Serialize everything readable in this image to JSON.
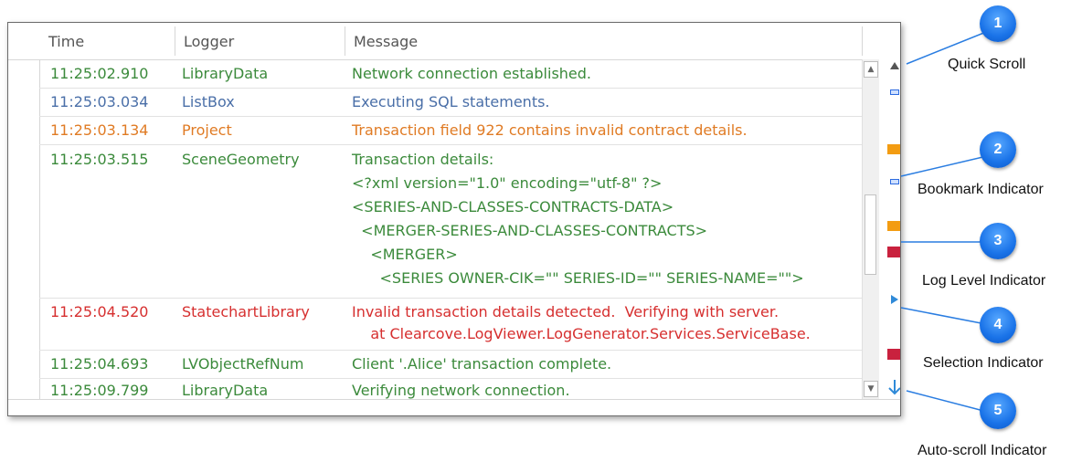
{
  "log_view": {
    "columns": {
      "time": "Time",
      "logger": "Logger",
      "message": "Message"
    },
    "rows": [
      {
        "time": "11:25:02.910",
        "logger": "LibraryData",
        "message": [
          "Network connection established."
        ],
        "color": "#3b8a3b"
      },
      {
        "time": "11:25:03.034",
        "logger": "ListBox",
        "message": [
          "Executing SQL statements."
        ],
        "color": "#4a6fa8"
      },
      {
        "time": "11:25:03.134",
        "logger": "Project",
        "message": [
          "Transaction field 922 contains invalid contract details."
        ],
        "color": "#e07b24"
      },
      {
        "time": "11:25:03.515",
        "logger": "SceneGeometry",
        "message": [
          "Transaction details:",
          "<?xml version=\"1.0\" encoding=\"utf-8\" ?>",
          "<SERIES-AND-CLASSES-CONTRACTS-DATA>",
          "  <MERGER-SERIES-AND-CLASSES-CONTRACTS>",
          "    <MERGER>",
          "      <SERIES OWNER-CIK=\"\" SERIES-ID=\"\" SERIES-NAME=\"\">"
        ],
        "color": "#3b8a3b"
      },
      {
        "time": "11:25:04.520",
        "logger": "StatechartLibrary",
        "message": [
          "Invalid transaction details detected.  Verifying with server.",
          "    at Clearcove.LogViewer.LogGenerator.Services.ServiceBase."
        ],
        "color": "#d62f2f"
      },
      {
        "time": "11:25:04.693",
        "logger": "LVObjectRefNum",
        "message": [
          "Client '.Alice' transaction complete."
        ],
        "color": "#3b8a3b"
      },
      {
        "time": "11:25:09.799",
        "logger": "LibraryData",
        "message": [
          "Verifying network connection."
        ],
        "color": "#3b8a3b"
      }
    ]
  },
  "indicator_colors": {
    "bookmark": "#2d6be0",
    "warning": "#f39c12",
    "error": "#c9213e",
    "selection": "#2f8ad8",
    "arrow": "#555555"
  },
  "callouts": [
    {
      "number": "1",
      "label": "Quick Scroll"
    },
    {
      "number": "2",
      "label": "Bookmark Indicator"
    },
    {
      "number": "3",
      "label": "Log Level Indicator"
    },
    {
      "number": "4",
      "label": "Selection Indicator"
    },
    {
      "number": "5",
      "label": "Auto-scroll Indicator"
    }
  ],
  "callout_color": "#1a73e8"
}
